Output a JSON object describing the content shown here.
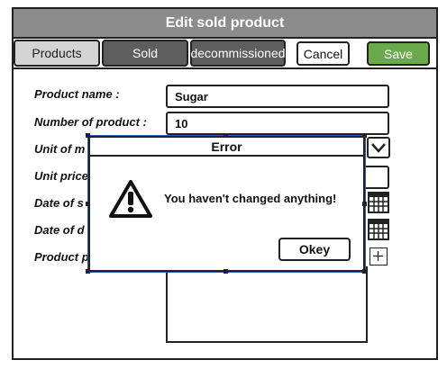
{
  "window": {
    "title": "Edit sold product"
  },
  "tabs": [
    {
      "label": "Products"
    },
    {
      "label": "Sold"
    },
    {
      "label": "decommissioned"
    }
  ],
  "actions": {
    "cancel_label": "Cancel",
    "save_label": "Save",
    "save_color": "#6aaa4a"
  },
  "form": {
    "product_name_label": "Product name :",
    "product_name_value": "Sugar",
    "number_label": "Number of product :",
    "number_value": "10",
    "unit_label": "Unit of m",
    "unit_price_label": "Unit price",
    "date_sold_label": "Date of s",
    "date_due_label": "Date of d",
    "product_p_label": "Product p"
  },
  "dialog": {
    "title": "Error",
    "message": "You haven't changed anything!",
    "ok_label": "Okey",
    "icon": "warning-icon"
  },
  "icons": {
    "dropdown": "chevron-down-icon",
    "calendar": "calendar-icon",
    "add": "plus-icon"
  }
}
